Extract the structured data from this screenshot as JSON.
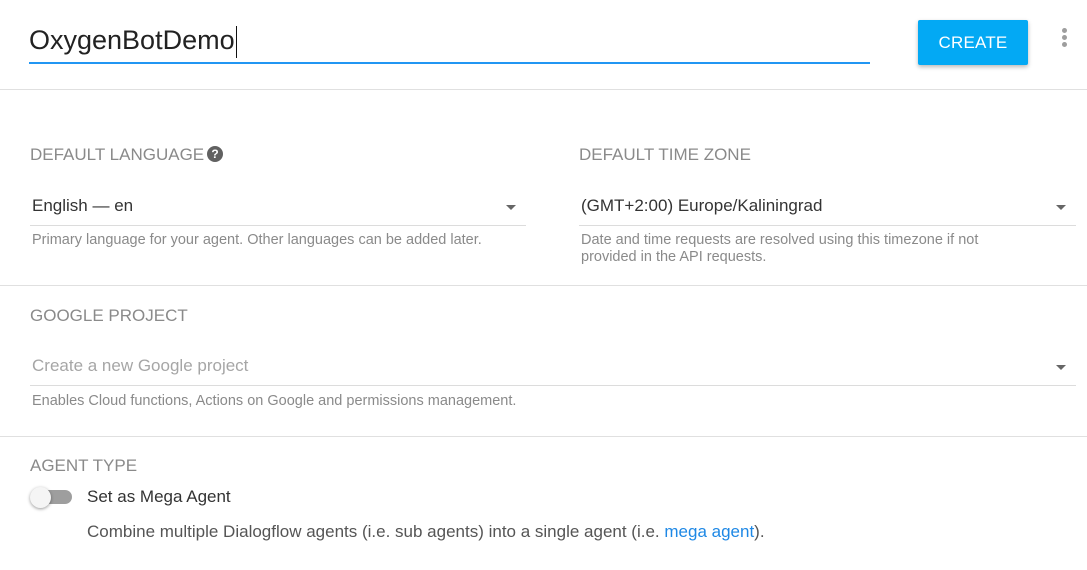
{
  "header": {
    "agent_name": "OxygenBotDemo",
    "create_label": "CREATE"
  },
  "language": {
    "label": "DEFAULT LANGUAGE",
    "value": "English — en",
    "hint": "Primary language for your agent. Other languages can be added later."
  },
  "timezone": {
    "label": "DEFAULT TIME ZONE",
    "value": "(GMT+2:00) Europe/Kaliningrad",
    "hint_line1": "Date and time requests are resolved using this timezone if not",
    "hint_line2": "provided in the API requests."
  },
  "google_project": {
    "label": "GOOGLE PROJECT",
    "placeholder": "Create a new Google project",
    "hint": "Enables Cloud functions, Actions on Google and permissions management."
  },
  "agent_type": {
    "label": "AGENT TYPE",
    "toggle_label": "Set as Mega Agent",
    "toggle_on": false,
    "desc_prefix": "Combine multiple Dialogflow agents (i.e. sub agents) into a single agent (i.e. ",
    "desc_link": "mega agent",
    "desc_suffix": ")."
  },
  "colors": {
    "accent": "#03a9f4",
    "underline": "#2196f3",
    "link": "#1e88e5"
  },
  "icons": {
    "help": "question-circle-icon",
    "more": "more-vertical-icon",
    "dropdown": "caret-down-icon"
  }
}
